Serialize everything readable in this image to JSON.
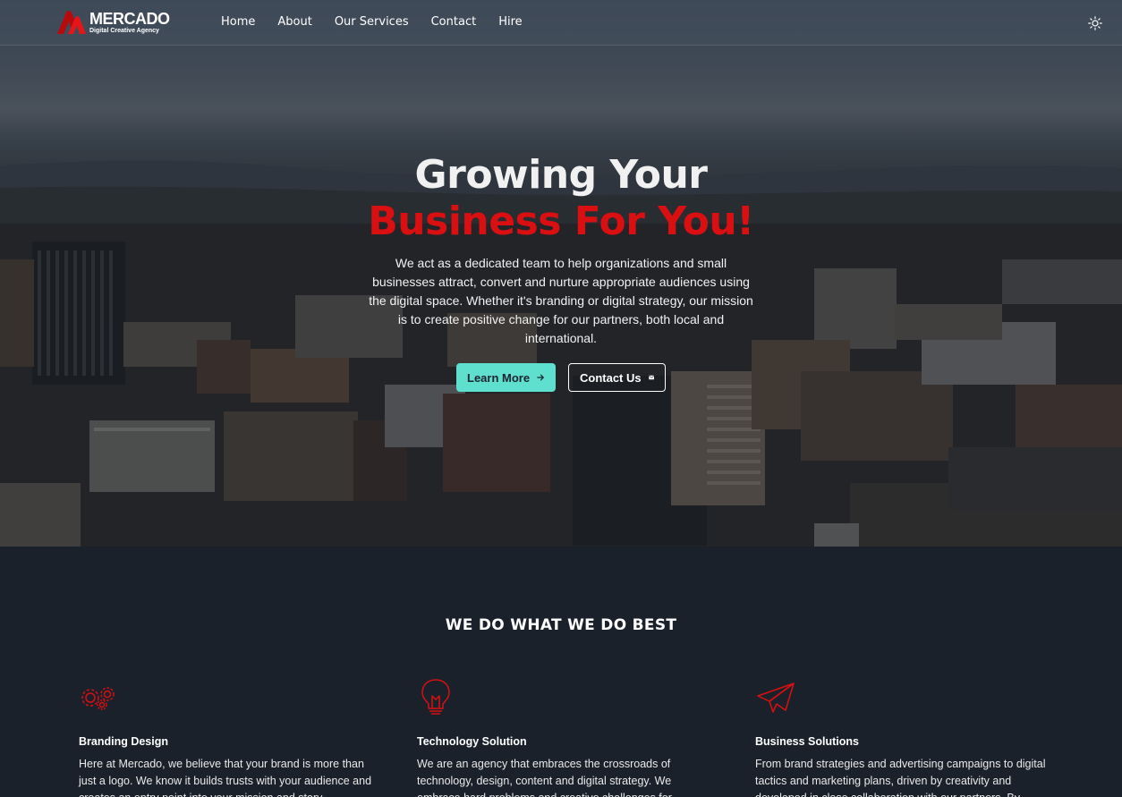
{
  "brand": {
    "name": "MERCADO",
    "tagline": "Digital Creative Agency"
  },
  "nav": {
    "items": [
      {
        "label": "Home"
      },
      {
        "label": "About"
      },
      {
        "label": "Our Services"
      },
      {
        "label": "Contact"
      },
      {
        "label": "Hire"
      }
    ],
    "theme_toggle_icon": "sun-icon"
  },
  "hero": {
    "title_line1": "Growing Your",
    "title_line2": "Business For You!",
    "description": "We act as a dedicated team to help organizations and small businesses attract, convert and nurture appropriate audiences using the digital space. Whether it's branding or digital strategy, our mission is to create positive change for our partners, both local and international.",
    "primary_button": {
      "label": "Learn More",
      "icon": "arrow-right-icon"
    },
    "secondary_button": {
      "label": "Contact Us",
      "icon": "envelope-icon"
    }
  },
  "services": {
    "title": "WE DO WHAT WE DO BEST",
    "cards": [
      {
        "icon": "gears-icon",
        "title": "Branding Design",
        "text": "Here at Mercado, we believe that your brand is more than just a logo. We know it builds trusts with your audience and creates an entry point into your mission and story."
      },
      {
        "icon": "lightbulb-icon",
        "title": "Technology Solution",
        "text": "We are an agency that embraces the crossroads of technology, design, content and digital strategy. We embrace hard problems and creative challenges for"
      },
      {
        "icon": "paper-plane-icon",
        "title": "Business Solutions",
        "text": "From brand strategies and advertising campaigns to digital tactics and marketing plans, driven by creativity and developed in close collaboration with our partners. By"
      }
    ]
  },
  "colors": {
    "accent_red": "#d90f12",
    "accent_teal": "#5fe0cf",
    "page_dark": "#1b212b"
  }
}
